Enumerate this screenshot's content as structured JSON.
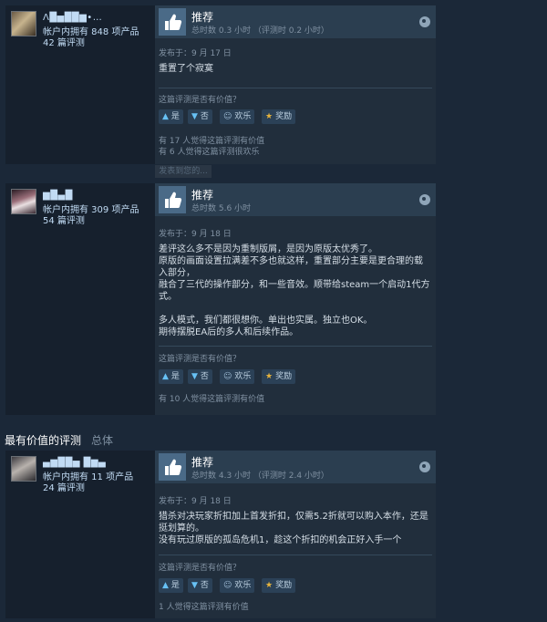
{
  "reviews": [
    {
      "author_name": "Λ█▅██▆•…",
      "owned": "帐户内拥有 848 项产品",
      "review_count": "42 篇评测",
      "title": "推荐",
      "hours": "总时数 0.3 小时 （评测时 0.2 小时）",
      "posted": "发布于：9 月 17 日",
      "body": [
        "重置了个寂寞"
      ],
      "helpful_question": "这篇评测是否有价值？",
      "vote_info": [
        "有 17 人觉得这篇评测有价值",
        "有 6 人觉得这篇评测很欢乐"
      ]
    },
    {
      "author_name": "▆█▄█",
      "owned": "帐户内拥有 309 项产品",
      "review_count": "54 篇评测",
      "title": "推荐",
      "hours": "总时数 5.6 小时",
      "posted": "发布于：9 月 18 日",
      "body": [
        "差评这么多不是因为重制版屑，是因为原版太优秀了。",
        "原版的画面设置拉满差不多也就这样，重置部分主要是更合理的载入部分，",
        "融合了三代的操作部分，和一些音效。顺带给steam一个启动1代方式。",
        "",
        "多人模式，我们都很想你。单出也实属。独立也OK。",
        "期待摆脱EA后的多人和后续作品。"
      ],
      "helpful_question": "这篇评测是否有价值？",
      "vote_info": [
        "有 10 人觉得这篇评测有价值"
      ]
    },
    {
      "author_name": "▄▆██▅ █▆▄",
      "owned": "帐户内拥有 11 项产品",
      "review_count": "24 篇评测",
      "title": "推荐",
      "hours": "总时数 4.3 小时 （评测时 2.4 小时）",
      "posted": "发布于：9 月 18 日",
      "body": [
        "猎杀对决玩家折扣加上首发折扣，仅需5.2折就可以购入本作，还是挺划算的。",
        "没有玩过原版的孤岛危机1，趁这个折扣的机会正好入手一个"
      ],
      "helpful_question": "这篇评测是否有价值？",
      "vote_info": [
        "1 人觉得这篇评测有价值"
      ]
    }
  ],
  "buttons": {
    "yes": "是",
    "no": "否",
    "funny": "欢乐",
    "award": "奖励"
  },
  "ghost_button": "发表到您的...",
  "section": {
    "title": "最有价值的评测",
    "subtitle": "总体"
  },
  "colors": {
    "accent": "#67c1f5",
    "award": "#e6b33d",
    "background": "#1b2838"
  },
  "icons": {
    "thumbs_up": "thumbs-up-icon",
    "thumbs_down": "thumbs-down-icon",
    "funny": "smile-icon",
    "award": "award-icon",
    "platform": "steam-icon"
  }
}
